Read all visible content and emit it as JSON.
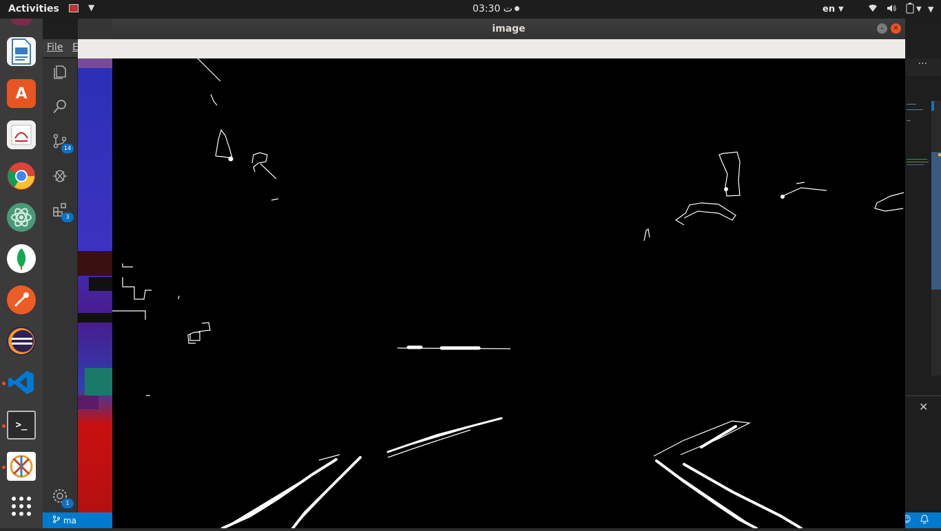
{
  "topbar": {
    "activities": "Activities",
    "clock": "03:30 ت",
    "lang": "en"
  },
  "dock": {
    "apps": [
      "libreoffice-writer",
      "ubuntu-software",
      "document-viewer",
      "chrome",
      "atom",
      "mongodb-compass",
      "postman",
      "eclipse",
      "vscode",
      "terminal",
      "app",
      "show-applications"
    ]
  },
  "vscode": {
    "menu_file": "File",
    "menu_edit": "E",
    "source_control_badge": "14",
    "extensions_badge": "3",
    "settings_badge": "1",
    "status_branch": "ma",
    "right_tabs_more": "···",
    "panel_close": "✕"
  },
  "window": {
    "title": "image",
    "close_symbol": "✕",
    "minimize_symbol": "–",
    "maximize_symbol": "▢"
  },
  "colors": {
    "ubuntu_orange": "#e95420",
    "vscode_blue": "#007acc",
    "edges": "#ffffff",
    "background": "#000000"
  }
}
